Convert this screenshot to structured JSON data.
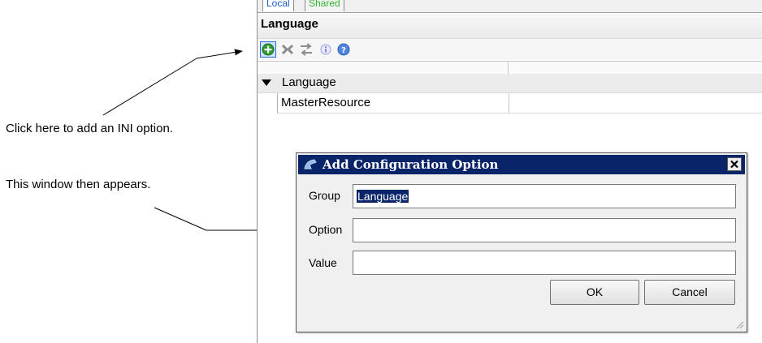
{
  "annotations": {
    "add_hint": "Click here to add an INI option.",
    "window_hint": "This window then appears."
  },
  "tabs": [
    {
      "label": "Local"
    },
    {
      "label": "Shared"
    }
  ],
  "section": {
    "title": "Language"
  },
  "toolbar": {
    "icons": [
      "add-icon",
      "delete-icon",
      "move-icon",
      "info-icon",
      "help-icon"
    ]
  },
  "grid": {
    "group_label": "Language",
    "items": [
      {
        "name": "MasterResource",
        "value": ""
      }
    ]
  },
  "dialog": {
    "title": "Add Configuration Option",
    "group_label": "Group",
    "group_value": "Language",
    "option_label": "Option",
    "option_value": "",
    "value_label": "Value",
    "value_value": "",
    "ok_label": "OK",
    "cancel_label": "Cancel"
  },
  "colors": {
    "titlebar": "#0a246a",
    "selection": "#0a246a",
    "local_tab": "#1a5bc4",
    "shared_tab": "#2fb52f"
  }
}
